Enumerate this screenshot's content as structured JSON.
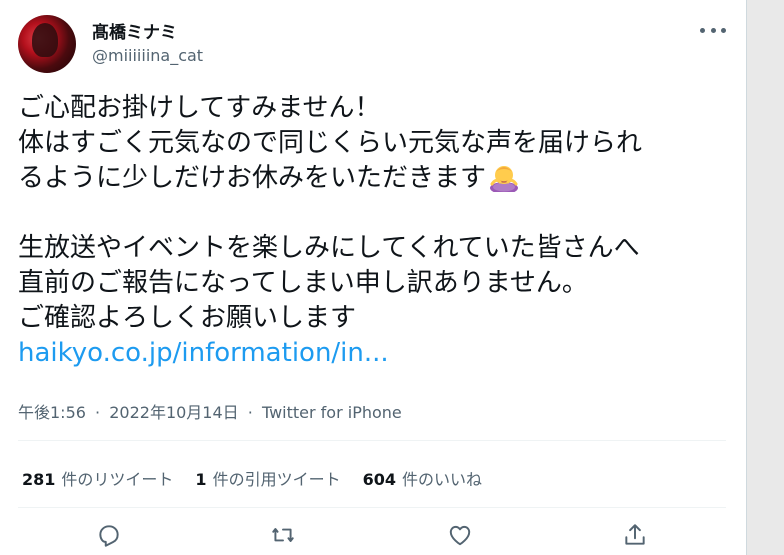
{
  "user": {
    "display_name": "髙橋ミナミ",
    "handle": "@miiiiiina_cat"
  },
  "tweet": {
    "lines": [
      "ご心配お掛けしてすみません！",
      "体はすごく元気なので同じくらい元気な声を届けられ",
      "るように少しだけお休みをいただきます"
    ],
    "lines2": [
      "生放送やイベントを楽しみにしてくれていた皆さんへ",
      "直前のご報告になってしまい申し訳ありません。",
      "ご確認よろしくお願いします"
    ],
    "link": "haikyo.co.jp/information/in...",
    "emoji": "person-bowing-emoji"
  },
  "meta": {
    "time": "午後1:56",
    "date": "2022年10月14日",
    "source": "Twitter for iPhone",
    "sep": "·"
  },
  "stats": {
    "retweets_count": "281",
    "retweets_label": "件のリツイート",
    "quotes_count": "1",
    "quotes_label": "件の引用ツイート",
    "likes_count": "604",
    "likes_label": "件のいいね"
  },
  "icons": {
    "more": "more-dots-icon",
    "reply": "reply-icon",
    "retweet": "retweet-icon",
    "like": "heart-icon",
    "share": "share-icon"
  },
  "colors": {
    "link": "#1d9bf0",
    "secondary_text": "#536471",
    "primary_text": "#0f1419"
  }
}
